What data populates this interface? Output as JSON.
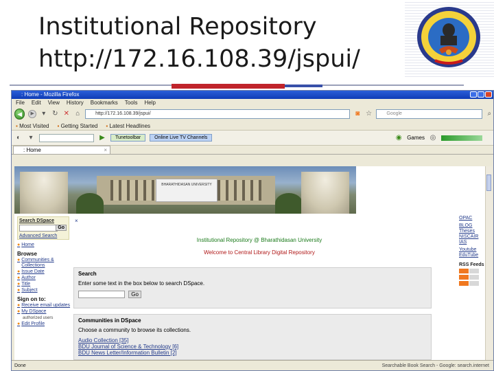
{
  "slide": {
    "title_line1": "Institutional Repository",
    "title_line2": "http://172.16.108.39/jspui/"
  },
  "browser": {
    "window_title": ": Home - Mozilla Firefox",
    "menu": [
      "File",
      "Edit",
      "View",
      "History",
      "Bookmarks",
      "Tools",
      "Help"
    ],
    "url": "http://172.16.108.39/jspui/",
    "search_placeholder": "Google",
    "bookmarks": [
      "Most Visited",
      "Getting Started",
      "Latest Headlines"
    ],
    "toolbar": {
      "tv_button": "Online Live TV Channels",
      "tab_placeholder": "Tunetoolbar",
      "games_label": "Games"
    },
    "tab_label": ": Home",
    "status_text": "Done",
    "status_right": "Searchable Book Search - Google: search.internet"
  },
  "page": {
    "banner_board": "BHARATHIDASAN UNIVERSITY",
    "search_dspace": "Search DSpace",
    "go_label": "Go",
    "advanced_search": "Advanced Search",
    "home": "Home",
    "browse_heading": "Browse",
    "browse_items": [
      "Communities & Collections",
      "Issue Date",
      "Author",
      "Title",
      "Subject"
    ],
    "signon_heading": "Sign on to:",
    "signon_items": [
      "Receive email updates",
      "My DSpace"
    ],
    "signon_note": "authorized users",
    "signon_more": "Edit Profile",
    "heading_green": "Institutional Repository @ Bharathidasan University",
    "heading_red": "Welcome to Central Library Digital Repository",
    "search_heading": "Search",
    "search_prompt": "Enter some text in the box below to search DSpace.",
    "search_go": "Go",
    "communities_heading": "Communities in DSpace",
    "communities_prompt": "Choose a community to browse its collections.",
    "collections": [
      "Audio Collection [35]",
      "BDU Journal of Science & Technology [6]",
      "BDU News Letter/Information Bulletin [2]"
    ],
    "right_links": [
      "OPAC",
      "BLOG Theses NISCAIR IAS",
      "Youtube EduTube"
    ],
    "rss_heading": "RSS Feeds"
  }
}
